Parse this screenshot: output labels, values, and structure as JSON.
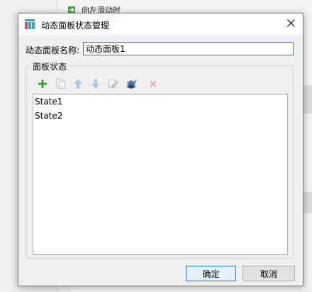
{
  "background": {
    "rows": [
      "向左滑动时"
    ]
  },
  "dialog": {
    "title": "动态面板状态管理",
    "name_label": "动态面板名称:",
    "name_value": "动态面板1",
    "group_label": "面板状态",
    "states": [
      "State1",
      "State2"
    ],
    "ok_label": "确定",
    "cancel_label": "取消"
  },
  "colors": {
    "accent": "#3c7fb1",
    "add_green": "#3aa335",
    "delete_red": "#f3a5a5"
  },
  "icons": {
    "toolbar": [
      "add-icon",
      "duplicate-icon",
      "move-up-icon",
      "move-down-icon",
      "edit-state-icon",
      "edit-all-icon",
      "delete-icon"
    ],
    "close": "close-icon",
    "app": "app-icon"
  }
}
